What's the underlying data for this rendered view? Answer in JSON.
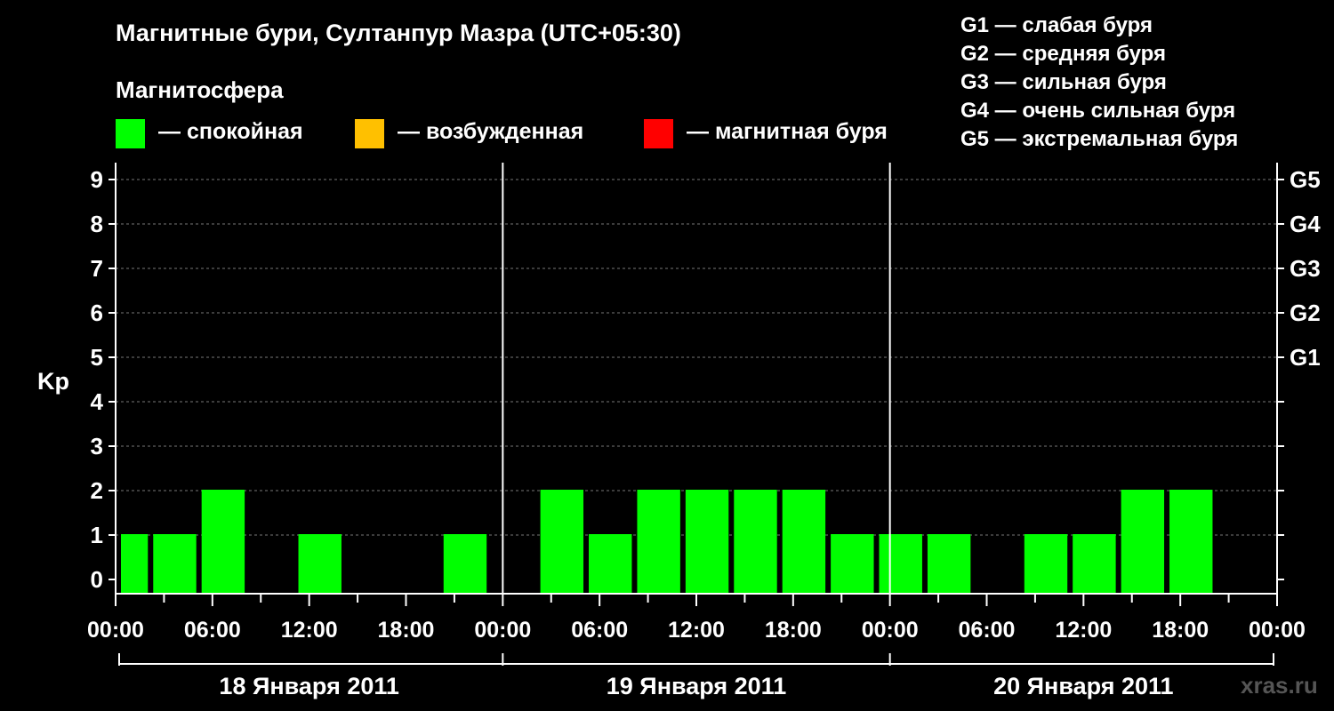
{
  "chart_data": {
    "type": "bar",
    "title": "Магнитные бури, Султанпур Мазра (UTC+05:30)",
    "ylabel": "Kp",
    "ylim": [
      0,
      9
    ],
    "y_ticks": [
      "0",
      "1",
      "2",
      "3",
      "4",
      "5",
      "6",
      "7",
      "8",
      "9"
    ],
    "g_scale_ticks": [
      {
        "kp": 5,
        "label": "G1"
      },
      {
        "kp": 6,
        "label": "G2"
      },
      {
        "kp": 7,
        "label": "G3"
      },
      {
        "kp": 8,
        "label": "G4"
      },
      {
        "kp": 9,
        "label": "G5"
      }
    ],
    "x_tick_labels": [
      "00:00",
      "06:00",
      "12:00",
      "18:00",
      "00:00",
      "06:00",
      "12:00",
      "18:00",
      "00:00",
      "06:00",
      "12:00",
      "18:00",
      "00:00"
    ],
    "days": [
      "18 Января 2011",
      "19 Января 2011",
      "20 Января 2011"
    ],
    "bars": [
      {
        "start_hour": 0,
        "end_hour": 2,
        "kp": 1
      },
      {
        "start_hour": 2,
        "end_hour": 5,
        "kp": 1
      },
      {
        "start_hour": 5,
        "end_hour": 8,
        "kp": 2
      },
      {
        "start_hour": 8,
        "end_hour": 11,
        "kp": 0
      },
      {
        "start_hour": 11,
        "end_hour": 14,
        "kp": 1
      },
      {
        "start_hour": 14,
        "end_hour": 17,
        "kp": 0
      },
      {
        "start_hour": 17,
        "end_hour": 20,
        "kp": 0
      },
      {
        "start_hour": 20,
        "end_hour": 23,
        "kp": 1
      },
      {
        "start_hour": 23,
        "end_hour": 26,
        "kp": 0
      },
      {
        "start_hour": 26,
        "end_hour": 29,
        "kp": 2
      },
      {
        "start_hour": 29,
        "end_hour": 32,
        "kp": 1
      },
      {
        "start_hour": 32,
        "end_hour": 35,
        "kp": 2
      },
      {
        "start_hour": 35,
        "end_hour": 38,
        "kp": 2
      },
      {
        "start_hour": 38,
        "end_hour": 41,
        "kp": 2
      },
      {
        "start_hour": 41,
        "end_hour": 44,
        "kp": 2
      },
      {
        "start_hour": 44,
        "end_hour": 47,
        "kp": 1
      },
      {
        "start_hour": 47,
        "end_hour": 50,
        "kp": 1
      },
      {
        "start_hour": 50,
        "end_hour": 53,
        "kp": 1
      },
      {
        "start_hour": 53,
        "end_hour": 56,
        "kp": 0
      },
      {
        "start_hour": 56,
        "end_hour": 59,
        "kp": 1
      },
      {
        "start_hour": 59,
        "end_hour": 62,
        "kp": 1
      },
      {
        "start_hour": 62,
        "end_hour": 65,
        "kp": 2
      },
      {
        "start_hour": 65,
        "end_hour": 68,
        "kp": 2
      }
    ],
    "grid": true,
    "colors": {
      "quiet": "#00ff00",
      "unsettled": "#ffc000",
      "storm": "#ff0000"
    }
  },
  "legend": {
    "heading": "Магнитосфера",
    "items": [
      {
        "color": "#00ff00",
        "label": "— спокойная"
      },
      {
        "color": "#ffc000",
        "label": "— возбужденная"
      },
      {
        "color": "#ff0000",
        "label": "— магнитная буря"
      }
    ]
  },
  "g_scale_legend": [
    "G1 — слабая буря",
    "G2 — средняя буря",
    "G3 — сильная буря",
    "G4 — очень сильная буря",
    "G5 — экстремальная буря"
  ],
  "watermark": "xras.ru"
}
